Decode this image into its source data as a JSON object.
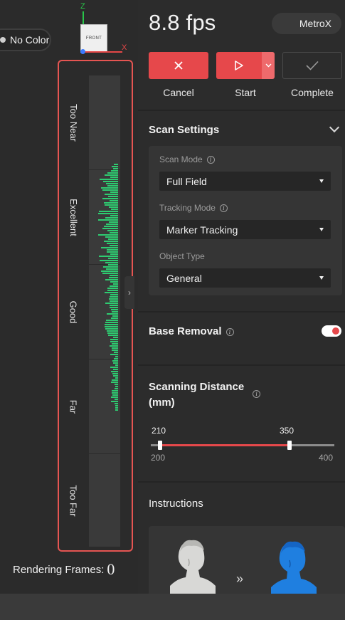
{
  "viewport": {
    "color_mode_label": "No Color",
    "axis": {
      "z_label": "Z",
      "x_label": "X",
      "cube_label": "FRONT"
    },
    "distance_zones": [
      "Too Near",
      "Excellent",
      "Good",
      "Far",
      "Too Far"
    ],
    "histogram_color": "#2ecc71",
    "rendering_frames_label": "Rendering Frames:",
    "rendering_frames_value": "0"
  },
  "header": {
    "fps": "8.8 fps",
    "device": "MetroX"
  },
  "actions": {
    "cancel_label": "Cancel",
    "start_label": "Start",
    "complete_label": "Complete"
  },
  "scan_settings": {
    "title": "Scan Settings",
    "scan_mode_label": "Scan Mode",
    "scan_mode_value": "Full Field",
    "tracking_mode_label": "Tracking Mode",
    "tracking_mode_value": "Marker Tracking",
    "object_type_label": "Object Type",
    "object_type_value": "General"
  },
  "base_removal": {
    "title": "Base Removal",
    "enabled": true
  },
  "scanning_distance": {
    "title_line1": "Scanning Distance",
    "title_line2": "(mm)",
    "low_value": "210",
    "high_value": "350",
    "min": "200",
    "max": "400"
  },
  "instructions": {
    "title": "Instructions",
    "arrows": "»"
  },
  "colors": {
    "accent": "#e6484b",
    "panel_bg": "#2c2c2c",
    "frame_highlight": "#e55552"
  }
}
